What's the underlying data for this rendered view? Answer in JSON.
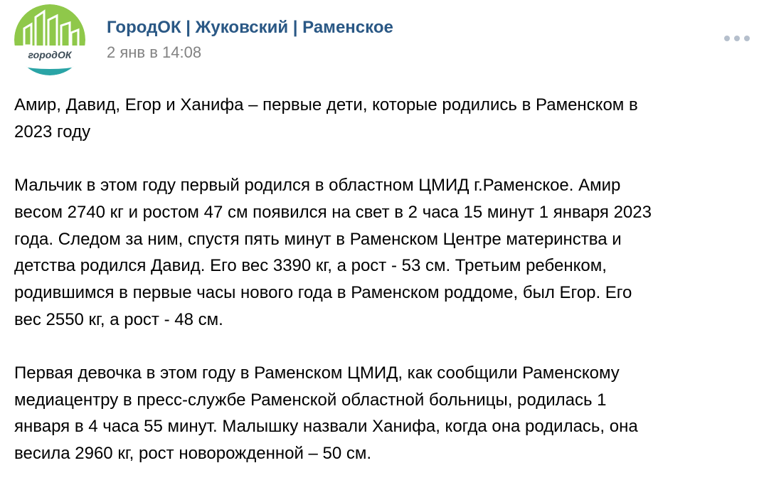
{
  "post": {
    "author": "ГородОК | Жуковский | Раменское",
    "date": "2 янв в 14:08",
    "avatar": {
      "logo_text": "городОК",
      "colors": {
        "top": "#8fc84a",
        "bottom": "#2aa4a6",
        "text": "#3a4a55"
      }
    },
    "more_icon": "more-horizontal-icon",
    "paragraphs": [
      "Амир, Давид, Егор и Ханифа – первые дети, которые родились в Раменском в\n2023 году",
      "Мальчик в этом году первый родился в областном ЦМИД г.Раменское. Амир\nвесом 2740 кг и ростом 47 см появился на свет в 2 часа 15 минут 1 января 2023\nгода. Следом за ним, спустя пять минут в Раменском Центре материнства и\nдетства родился Давид. Его вес 3390 кг, а рост - 53 см. Третьим ребенком,\nродившимся в первые часы нового года в Раменском роддоме, был Егор. Его\nвес 2550 кг, а рост - 48 см.",
      "Первая девочка в этом году в Раменском ЦМИД, как сообщили Раменскому\nмедиацентру в пресс-службе Раменской областной больницы, родилась 1\nянваря в 4 часа 55 минут. Малышку назвали Ханифа, когда она родилась, она\nвесила 2960 кг, рост новорожденной – 50 см."
    ]
  }
}
